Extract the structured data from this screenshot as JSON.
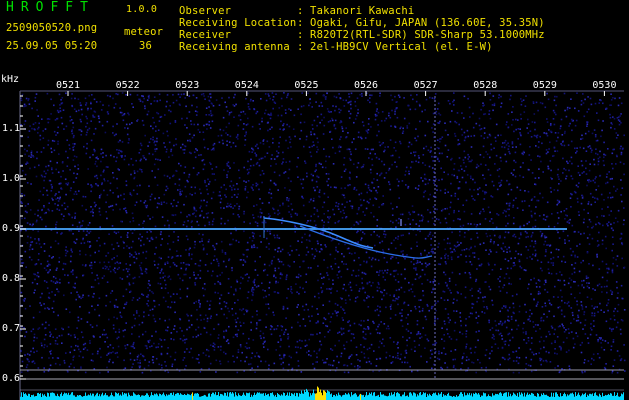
{
  "app": {
    "title": "HROFFT",
    "version": "1.0.0"
  },
  "file": {
    "name": "2509050520.png",
    "datetime": "25.09.05 05:20"
  },
  "mode": {
    "label": "meteor",
    "count": "36"
  },
  "info": [
    {
      "label": "Observer",
      "value": ": Takanori Kawachi"
    },
    {
      "label": "Receiving Location",
      "value": ": Ogaki, Gifu, JAPAN (136.60E, 35.35N)"
    },
    {
      "label": "Receiver",
      "value": ": R820T2(RTL-SDR) SDR-Sharp 53.1000MHz"
    },
    {
      "label": "Receiving antenna",
      "value": ": 2el-HB9CV Vertical (el. E-W)"
    }
  ],
  "axis": {
    "unit": "kHz",
    "time_ticks": [
      "0521",
      "0522",
      "0523",
      "0524",
      "0525",
      "0526",
      "0527",
      "0528",
      "0529",
      "0530"
    ],
    "freq_ticks": [
      "1.1",
      "1.0",
      "0.9",
      "0.8",
      "0.7",
      "0.6"
    ]
  },
  "colors": {
    "background": "#000000",
    "noise": "#1a1a9a",
    "signal": "#3fa0ff",
    "level": "#00e0ff",
    "level_peak": "#ffe000",
    "text_green": "#00e000",
    "text_yellow": "#f0e000"
  }
}
